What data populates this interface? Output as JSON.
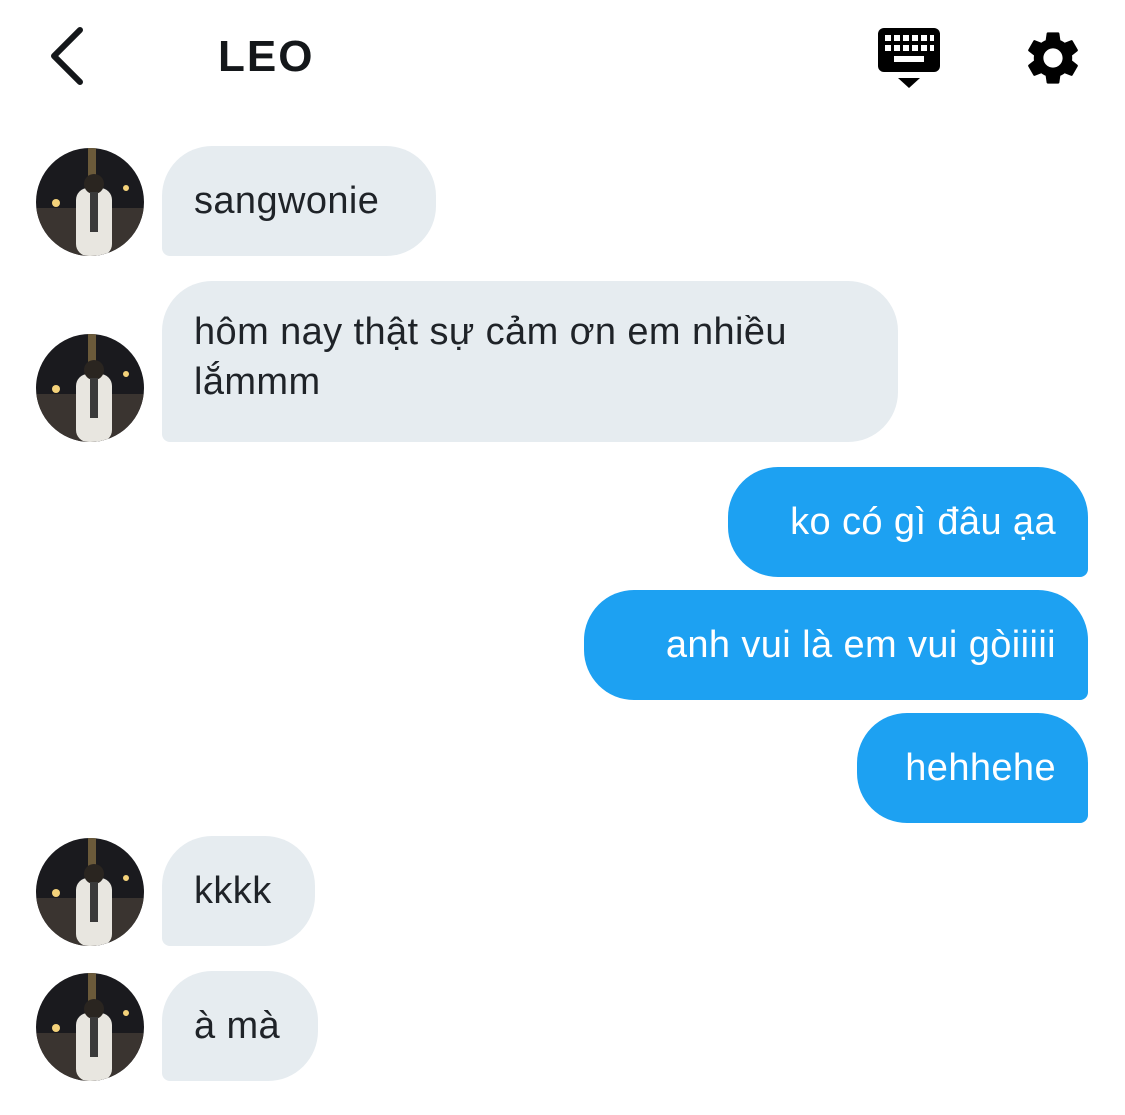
{
  "header": {
    "title": "LEO",
    "back_icon": "chevron-left-icon",
    "keyboard_icon": "keyboard-hide-icon",
    "settings_icon": "gear-icon"
  },
  "colors": {
    "incoming_bubble": "#e6ecf0",
    "outgoing_bubble": "#1da1f2",
    "text_dark": "#1f2328",
    "text_light": "#ffffff"
  },
  "messages": [
    {
      "direction": "in",
      "text": "sangwonie"
    },
    {
      "direction": "in",
      "text": "hôm nay thật sự cảm ơn em nhiều lắmmm"
    },
    {
      "direction": "out",
      "text": "ko có gì đâu ạa"
    },
    {
      "direction": "out",
      "text": "anh vui là em vui gòiiiii"
    },
    {
      "direction": "out",
      "text": "hehhehe"
    },
    {
      "direction": "in",
      "text": "kkkk"
    },
    {
      "direction": "in",
      "text": "à mà"
    }
  ]
}
